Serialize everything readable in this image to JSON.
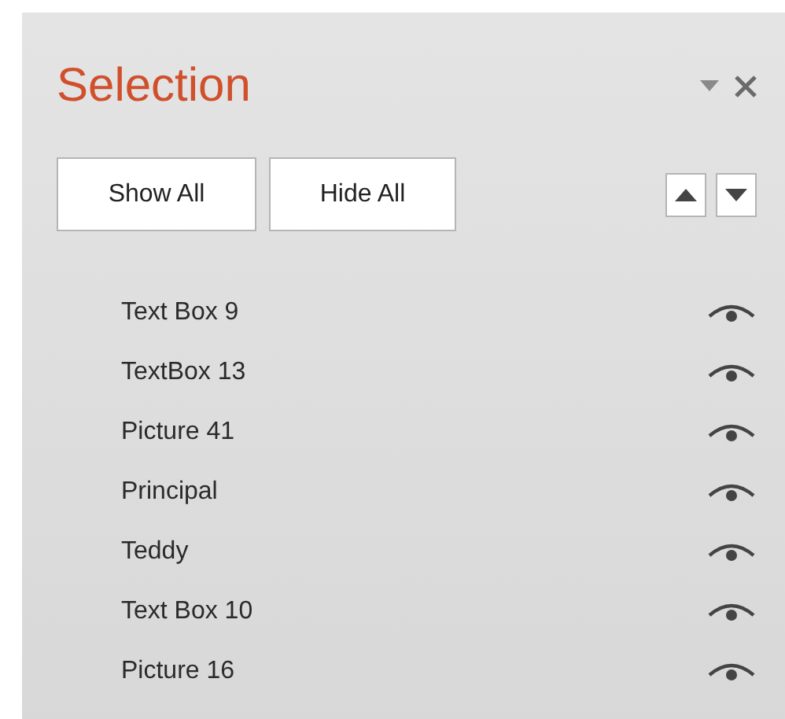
{
  "pane": {
    "title": "Selection"
  },
  "buttons": [
    "Show All",
    "Hide All"
  ],
  "items": [
    {
      "name": "Text Box 9",
      "visible": true
    },
    {
      "name": "TextBox 13",
      "visible": true
    },
    {
      "name": "Picture 41",
      "visible": true
    },
    {
      "name": "Principal",
      "visible": true
    },
    {
      "name": "Teddy",
      "visible": true
    },
    {
      "name": "Text Box 10",
      "visible": true
    },
    {
      "name": "Picture 16",
      "visible": true
    }
  ]
}
